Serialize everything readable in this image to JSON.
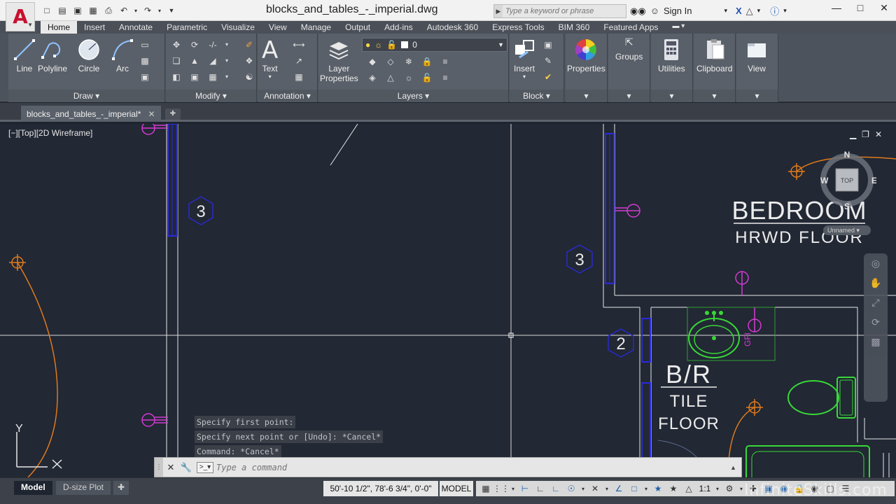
{
  "titlebar": {
    "doc_title": "blocks_and_tables_-_imperial.dwg",
    "search_placeholder": "Type a keyword or phrase",
    "sign_in": "Sign In"
  },
  "ribbon_tabs": [
    "Home",
    "Insert",
    "Annotate",
    "Parametric",
    "Visualize",
    "View",
    "Manage",
    "Output",
    "Add-ins",
    "Autodesk 360",
    "Express Tools",
    "BIM 360",
    "Featured Apps"
  ],
  "ribbon": {
    "draw": {
      "title": "Draw",
      "line": "Line",
      "polyline": "Polyline",
      "circle": "Circle",
      "arc": "Arc"
    },
    "modify": {
      "title": "Modify"
    },
    "annotation": {
      "title": "Annotation",
      "text": "Text"
    },
    "layers": {
      "title": "Layers",
      "layer_properties_1": "Layer",
      "layer_properties_2": "Properties",
      "current_layer": "0"
    },
    "block": {
      "title": "Block",
      "insert": "Insert"
    },
    "properties": "Properties",
    "groups": "Groups",
    "utilities": "Utilities",
    "clipboard": "Clipboard",
    "view": "View"
  },
  "file_tab": "blocks_and_tables_-_imperial*",
  "viewport": {
    "label": "[−][Top][2D Wireframe]",
    "compass": {
      "n": "N",
      "s": "S",
      "e": "E",
      "w": "W",
      "top": "TOP",
      "ucs": "Unnamed"
    }
  },
  "drawing_text": {
    "bedroom": "BEDROOM",
    "hrwd_floor": "HRWD FLOOR",
    "br": "B/R",
    "tile": "TILE",
    "floor": "FLOOR",
    "gfi": "GFI",
    "tag_3a": "3",
    "tag_3b": "3",
    "tag_2": "2",
    "axis_y": "Y"
  },
  "command": {
    "history": [
      "Specify first point:",
      "Specify next point or [Undo]: *Cancel*",
      "Command: *Cancel*"
    ],
    "placeholder": "Type a command"
  },
  "status": {
    "tabs": [
      "Model",
      "D-size Plot"
    ],
    "coords": "50'-10 1/2\", 78'-6 3/4\", 0'-0\"",
    "model": "MODEL",
    "scale": "1:1"
  },
  "watermark": "InfiniteSkills.com",
  "colors": {
    "canvas": "#222834",
    "walls": "#e8e8e8",
    "magenta": "#d43ad4",
    "orange": "#e07a1c",
    "green": "#38d838",
    "blue_tag": "#2a2ac8"
  }
}
